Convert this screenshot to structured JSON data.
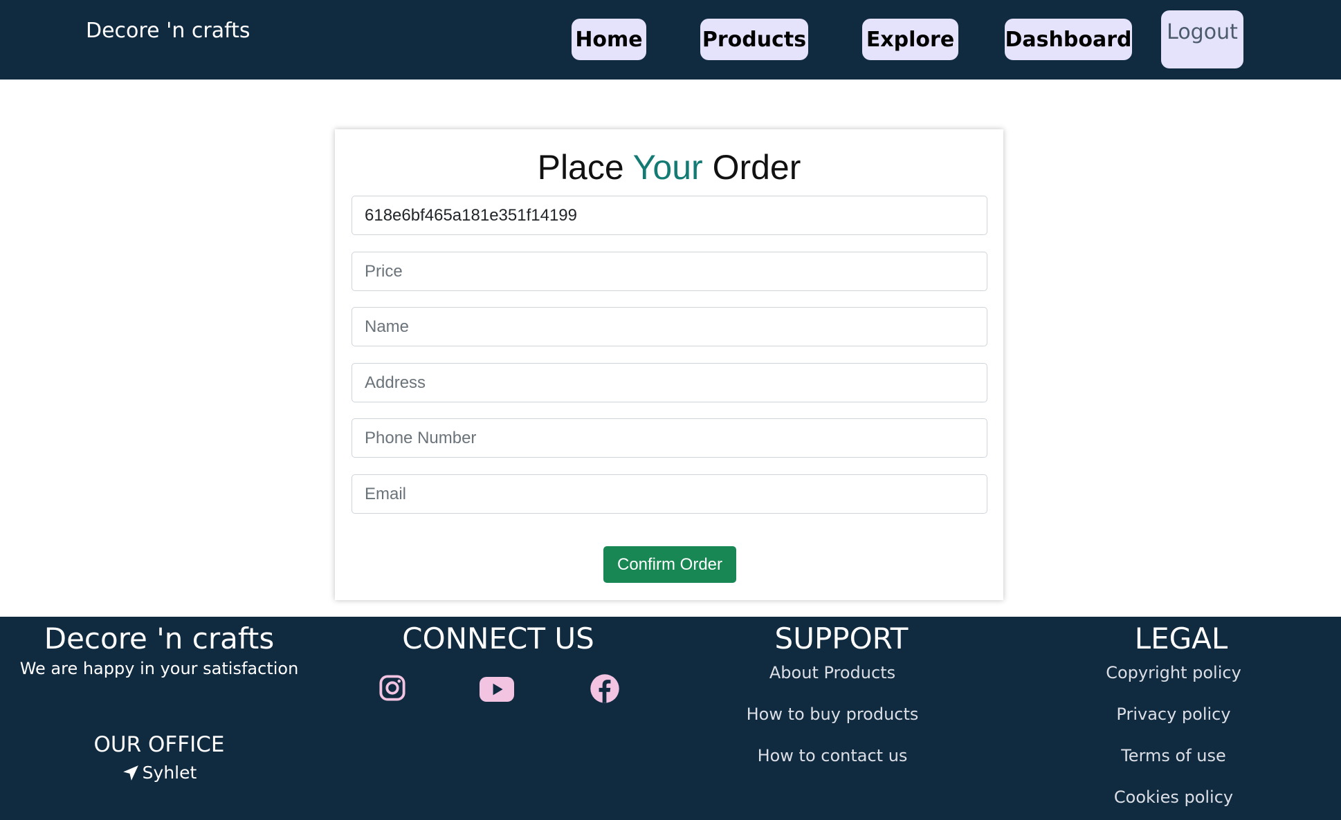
{
  "header": {
    "brand": "Decore 'n crafts",
    "nav": {
      "home": "Home",
      "products": "Products",
      "explore": "Explore",
      "dashboard": "Dashboard",
      "logout": "Logout"
    }
  },
  "order_form": {
    "title_part1": "Place ",
    "title_accent": "Your",
    "title_part2": " Order",
    "product_id_value": "618e6bf465a181e351f14199",
    "price_placeholder": "Price",
    "name_placeholder": "Name",
    "address_placeholder": "Address",
    "phone_placeholder": "Phone Number",
    "email_placeholder": "Email",
    "confirm_label": "Confirm Order"
  },
  "footer": {
    "brand": "Decore 'n crafts",
    "tagline": "We are happy in your satisfaction",
    "office_title": "OUR OFFICE",
    "office_location": "Syhlet",
    "connect_title": "CONNECT US",
    "social_icons": [
      "instagram-icon",
      "youtube-icon",
      "facebook-icon"
    ],
    "support_title": "SUPPORT",
    "support_links": [
      "About Products",
      "How to buy products",
      "How to contact us"
    ],
    "legal_title": "LEGAL",
    "legal_links": [
      "Copyright policy",
      "Privacy policy",
      "Terms of use",
      "Cookies policy"
    ]
  },
  "colors": {
    "navy": "#102a40",
    "nav_button": "#e5e2fb",
    "accent_teal": "#147a74",
    "confirm_green": "#198754",
    "social_pink": "#f3c4e2"
  }
}
